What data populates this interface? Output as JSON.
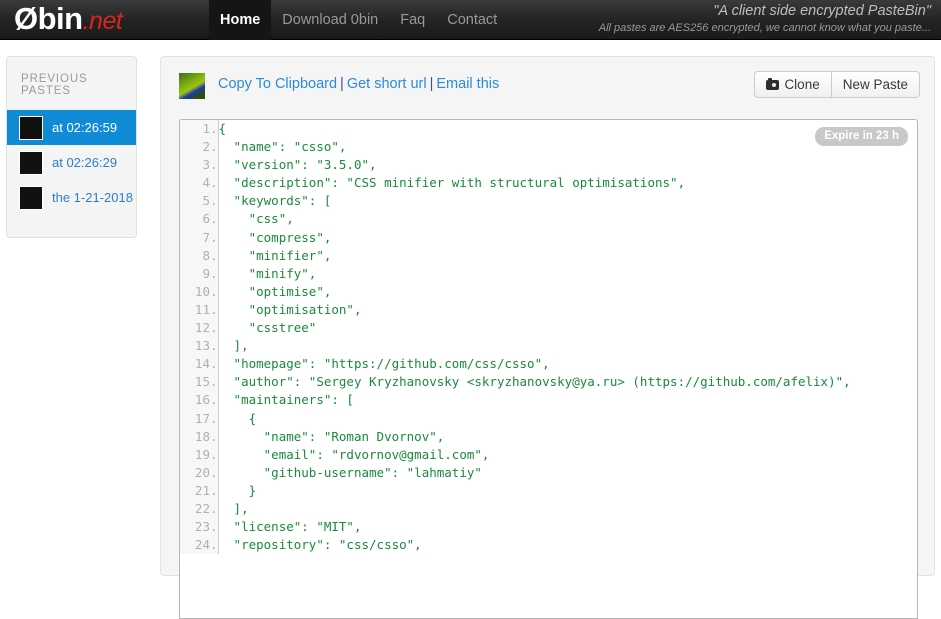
{
  "navbar": {
    "brand_main": "Øbin",
    "brand_tld": ".net",
    "links": [
      {
        "label": "Home",
        "active": true
      },
      {
        "label": "Download 0bin",
        "active": false
      },
      {
        "label": "Faq",
        "active": false
      },
      {
        "label": "Contact",
        "active": false
      }
    ],
    "tagline_primary": "\"A client side encrypted PasteBin\"",
    "tagline_secondary": "All pastes are AES256 encrypted, we cannot know what you paste..."
  },
  "sidebar": {
    "title": "PREVIOUS PASTES",
    "items": [
      {
        "label": "at 02:26:59",
        "active": true,
        "thumb": "green-olive-identicon"
      },
      {
        "label": "at 02:26:29",
        "active": false,
        "thumb": "dark-blue-identicon"
      },
      {
        "label": "the 1-21-2018",
        "active": false,
        "thumb": "teal-identicon"
      }
    ]
  },
  "toolbar": {
    "thumb": "green-olive-identicon",
    "copy_label": "Copy To Clipboard",
    "shorturl_label": "Get short url",
    "email_label": "Email this",
    "separator": "|",
    "clone_label": "Clone",
    "newpaste_label": "New Paste"
  },
  "paste": {
    "expire_badge": "Expire in 23 h",
    "code_lines": [
      "{",
      "  \"name\": \"csso\",",
      "  \"version\": \"3.5.0\",",
      "  \"description\": \"CSS minifier with structural optimisations\",",
      "  \"keywords\": [",
      "    \"css\",",
      "    \"compress\",",
      "    \"minifier\",",
      "    \"minify\",",
      "    \"optimise\",",
      "    \"optimisation\",",
      "    \"csstree\"",
      "  ],",
      "  \"homepage\": \"https://github.com/css/csso\",",
      "  \"author\": \"Sergey Kryzhanovsky <skryzhanovsky@ya.ru> (https://github.com/afelix)\",",
      "  \"maintainers\": [",
      "    {",
      "      \"name\": \"Roman Dvornov\",",
      "      \"email\": \"rdvornov@gmail.com\",",
      "      \"github-username\": \"lahmatiy\"",
      "    }",
      "  ],",
      "  \"license\": \"MIT\",",
      "  \"repository\": \"css/csso\","
    ]
  },
  "colors": {
    "navbar_bg": "#222222",
    "accent_blue": "#108cd6",
    "link_blue": "#2a8bd8",
    "code_green": "#1a8a3c",
    "brand_red": "#d9241f",
    "badge_gray": "#c8c8c8"
  }
}
